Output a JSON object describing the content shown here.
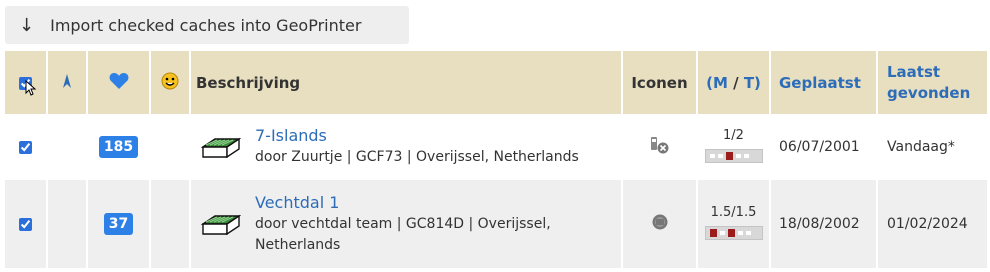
{
  "toolbar": {
    "import_label": "Import checked caches into GeoPrinter",
    "import_icon": "down-arrow-icon"
  },
  "table": {
    "headers": {
      "select_all_icon": "checkbox-icon",
      "direction_icon": "north-arrow-icon",
      "favorites_icon": "heart-icon",
      "found_icon": "smiley-icon",
      "description": "Beschrijving",
      "icons": "Iconen",
      "difficulty_prefix": "(",
      "difficulty_m": "M",
      "difficulty_sep": " / ",
      "difficulty_t": "T",
      "difficulty_suffix": ")",
      "placed": "Geplaatst",
      "last_found": "Laatst gevonden"
    },
    "rows": [
      {
        "checked": true,
        "favorites": "185",
        "name": "7-Islands",
        "details": "door Zuurtje | GCF73 | Overijssel, Netherlands",
        "attribute_icon": "wheelchair-no-icon",
        "dt": "1/2",
        "placed": "06/07/2001",
        "last_found": "Vandaag*"
      },
      {
        "checked": true,
        "favorites": "37",
        "name": "Vechtdal 1",
        "details": "door vechtdal team | GC814D | Overijssel, Netherlands",
        "attribute_icon": "gear-icon",
        "dt": "1.5/1.5",
        "placed": "18/08/2002",
        "last_found": "01/02/2024"
      }
    ]
  },
  "colors": {
    "header_bg": "#e8dfc0",
    "link": "#2c6cb8",
    "badge": "#2d80e6",
    "row_alt": "#f0efef"
  }
}
